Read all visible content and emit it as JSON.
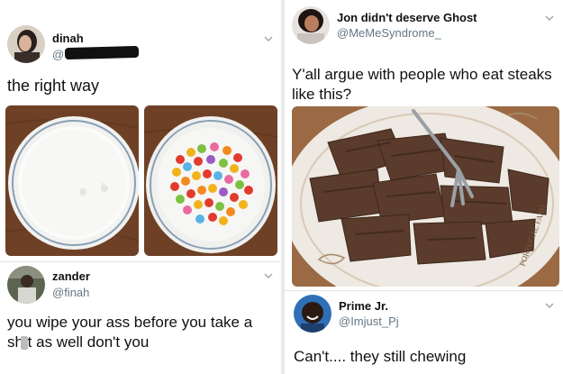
{
  "left_panel": {
    "tweet1": {
      "display_name": "dinah",
      "handle": "@",
      "text": "the right way",
      "avatar": "avatar-dinah",
      "menu_icon": "chevron-down-icon"
    },
    "tweet2": {
      "display_name": "zander",
      "handle": "@finah",
      "text_line1": "you wipe your ass before you take a",
      "text_line2": "sh t as well don't you",
      "avatar": "avatar-zander",
      "menu_icon": "chevron-down-icon"
    },
    "images": [
      "bowl-of-milk-image",
      "bowl-of-cereal-image"
    ]
  },
  "right_panel": {
    "tweet1": {
      "display_name": "Jon didn't deserve Ghost",
      "handle": "@MeMeSyndrome_",
      "text_line1": "Y'all argue with people who eat steaks",
      "text_line2": "like this?",
      "plate_text": "PORTUGAL FASH",
      "menu_icon": "chevron-down-icon"
    },
    "tweet2": {
      "display_name": "Prime Jr.",
      "handle": "@Imjust_Pj",
      "text": "Can't.... they still chewing",
      "menu_icon": "chevron-down-icon"
    }
  },
  "colors": {
    "name": "#111111",
    "handle": "#657786",
    "divider": "#e3e3e3",
    "table_wood": "#7a4a2c"
  }
}
